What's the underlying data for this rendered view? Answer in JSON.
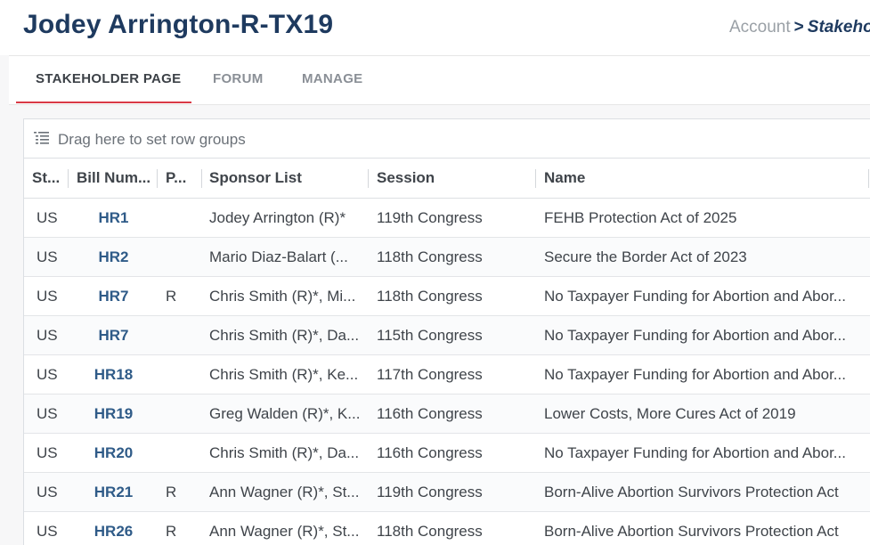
{
  "header": {
    "title": "Jodey Arrington-R-TX19",
    "breadcrumb": {
      "parent": "Account",
      "separator": ">",
      "current": "Stakeholder Page"
    }
  },
  "tabs": [
    {
      "label": "STAKEHOLDER PAGE",
      "active": true
    },
    {
      "label": "FORUM",
      "active": false
    },
    {
      "label": "MANAGE",
      "active": false
    }
  ],
  "grid": {
    "group_panel_text": "Drag here to set row groups",
    "group_icon": "row-groups-icon",
    "columns": [
      "St...",
      "Bill Num...",
      "P...",
      "Sponsor List",
      "Session",
      "Name"
    ],
    "rows": [
      {
        "state": "US",
        "bill": "HR1",
        "party": "",
        "sponsors": "Jodey Arrington (R)*",
        "session": "119th Congress",
        "name": "FEHB Protection Act of 2025"
      },
      {
        "state": "US",
        "bill": "HR2",
        "party": "",
        "sponsors": "Mario Diaz-Balart (...",
        "session": "118th Congress",
        "name": "Secure the Border Act of 2023"
      },
      {
        "state": "US",
        "bill": "HR7",
        "party": "R",
        "sponsors": "Chris Smith (R)*, Mi...",
        "session": "118th Congress",
        "name": "No Taxpayer Funding for Abortion and Abor..."
      },
      {
        "state": "US",
        "bill": "HR7",
        "party": "",
        "sponsors": "Chris Smith (R)*, Da...",
        "session": "115th Congress",
        "name": "No Taxpayer Funding for Abortion and Abor..."
      },
      {
        "state": "US",
        "bill": "HR18",
        "party": "",
        "sponsors": "Chris Smith (R)*, Ke...",
        "session": "117th Congress",
        "name": "No Taxpayer Funding for Abortion and Abor..."
      },
      {
        "state": "US",
        "bill": "HR19",
        "party": "",
        "sponsors": "Greg Walden (R)*, K...",
        "session": "116th Congress",
        "name": "Lower Costs, More Cures Act of 2019"
      },
      {
        "state": "US",
        "bill": "HR20",
        "party": "",
        "sponsors": "Chris Smith (R)*, Da...",
        "session": "116th Congress",
        "name": "No Taxpayer Funding for Abortion and Abor..."
      },
      {
        "state": "US",
        "bill": "HR21",
        "party": "R",
        "sponsors": "Ann Wagner (R)*, St...",
        "session": "119th Congress",
        "name": "Born-Alive Abortion Survivors Protection Act"
      },
      {
        "state": "US",
        "bill": "HR26",
        "party": "R",
        "sponsors": "Ann Wagner (R)*, St...",
        "session": "118th Congress",
        "name": "Born-Alive Abortion Survivors Protection Act"
      }
    ]
  },
  "colors": {
    "title": "#1e3a5f",
    "accent": "#d93a46",
    "bill_link": "#2f5b88"
  }
}
